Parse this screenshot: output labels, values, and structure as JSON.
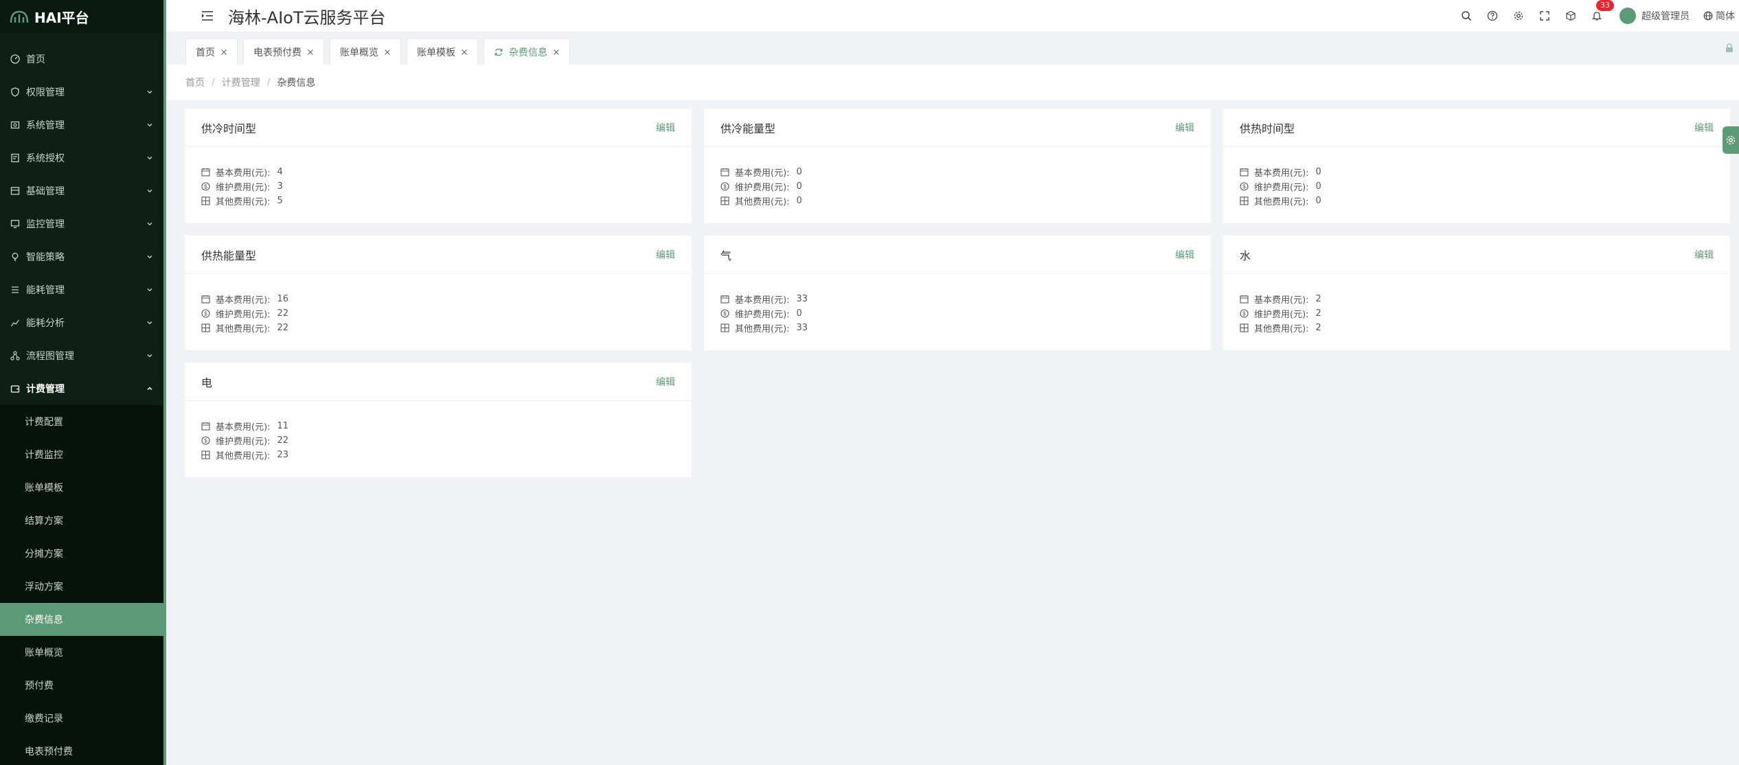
{
  "brand": {
    "name": "HAI平台"
  },
  "header": {
    "title": "海林-AIoT云服务平台",
    "notification_count": "33",
    "user_name": "超级管理员",
    "language": "简体"
  },
  "menu": {
    "items": [
      {
        "label": "首页"
      },
      {
        "label": "权限管理"
      },
      {
        "label": "系统管理"
      },
      {
        "label": "系统授权"
      },
      {
        "label": "基础管理"
      },
      {
        "label": "监控管理"
      },
      {
        "label": "智能策略"
      },
      {
        "label": "能耗管理"
      },
      {
        "label": "能耗分析"
      },
      {
        "label": "流程图管理"
      },
      {
        "label": "计费管理"
      }
    ],
    "sub_items": [
      {
        "label": "计费配置"
      },
      {
        "label": "计费监控"
      },
      {
        "label": "账单模板"
      },
      {
        "label": "结算方案"
      },
      {
        "label": "分摊方案"
      },
      {
        "label": "浮动方案"
      },
      {
        "label": "杂费信息"
      },
      {
        "label": "账单概览"
      },
      {
        "label": "预付费"
      },
      {
        "label": "缴费记录"
      },
      {
        "label": "电表预付费"
      }
    ]
  },
  "tabs": [
    {
      "label": "首页"
    },
    {
      "label": "电表预付费"
    },
    {
      "label": "账单概览"
    },
    {
      "label": "账单模板"
    },
    {
      "label": "杂费信息"
    }
  ],
  "breadcrumb": [
    "首页",
    "计费管理",
    "杂费信息"
  ],
  "labels": {
    "base_fee": "基本费用(元):",
    "maintenance_fee": "维护费用(元):",
    "other_fee": "其他费用(元):",
    "edit": "编辑"
  },
  "cards": [
    {
      "title": "供冷时间型",
      "base": "4",
      "maintenance": "3",
      "other": "5"
    },
    {
      "title": "供冷能量型",
      "base": "0",
      "maintenance": "0",
      "other": "0"
    },
    {
      "title": "供热时间型",
      "base": "0",
      "maintenance": "0",
      "other": "0"
    },
    {
      "title": "供热能量型",
      "base": "16",
      "maintenance": "22",
      "other": "22"
    },
    {
      "title": "气",
      "base": "33",
      "maintenance": "0",
      "other": "33"
    },
    {
      "title": "水",
      "base": "2",
      "maintenance": "2",
      "other": "2"
    },
    {
      "title": "电",
      "base": "11",
      "maintenance": "22",
      "other": "23"
    }
  ],
  "colors": {
    "accent": "#5c9b78",
    "sidebar_bg": "#0d1f17",
    "badge": "#f5222d"
  }
}
